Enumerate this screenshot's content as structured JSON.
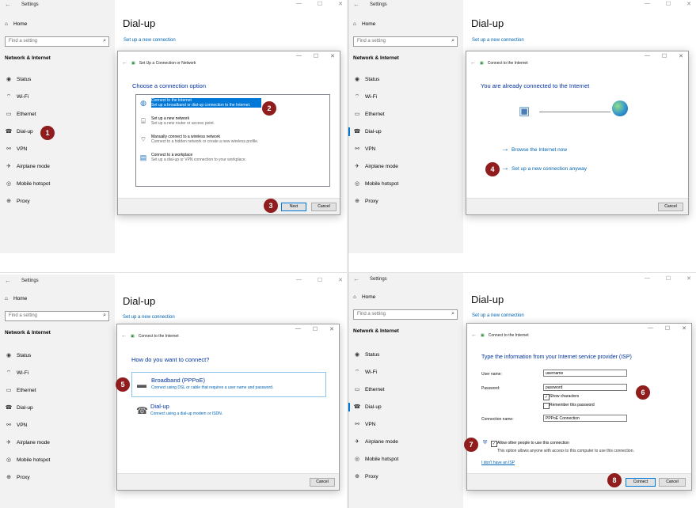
{
  "settings": {
    "app_title": "Settings",
    "home": "Home",
    "search_placeholder": "Find a setting",
    "section": "Network & Internet",
    "nav": [
      "Status",
      "Wi-Fi",
      "Ethernet",
      "Dial-up",
      "VPN",
      "Airplane mode",
      "Mobile hotspot",
      "Proxy"
    ],
    "page_title": "Dial-up",
    "setup_link": "Set up a new connection"
  },
  "step1": {
    "dialog_title": "Set Up a Connection or Network",
    "heading": "Choose a connection option",
    "options": [
      {
        "title": "Connect to the Internet",
        "desc": "Set up a broadband or dial-up connection to the Internet."
      },
      {
        "title": "Set up a new network",
        "desc": "Set up a new router or access point."
      },
      {
        "title": "Manually connect to a wireless network",
        "desc": "Connect to a hidden network or create a new wireless profile."
      },
      {
        "title": "Connect to a workplace",
        "desc": "Set up a dial-up or VPN connection to your workplace."
      }
    ],
    "next": "Next",
    "cancel": "Cancel"
  },
  "step2": {
    "dialog_title": "Connect to the Internet",
    "heading": "You are already connected to the Internet",
    "browse": "Browse the Internet now",
    "setup_anyway": "Set up a new connection anyway",
    "cancel": "Cancel"
  },
  "step3": {
    "dialog_title": "Connect to the Internet",
    "heading": "How do you want to connect?",
    "broadband_title": "Broadband (PPPoE)",
    "broadband_desc": "Connect using DSL or cable that requires a user name and password.",
    "dialup_title": "Dial-up",
    "dialup_desc": "Connect using a dial-up modem or ISDN.",
    "cancel": "Cancel"
  },
  "step4": {
    "dialog_title": "Connect to the Internet",
    "heading": "Type the information from your Internet service provider (ISP)",
    "user_label": "User name:",
    "user_value": "username",
    "password_label": "Password:",
    "password_value": "password",
    "show_chars": "Show characters",
    "remember": "Remember this password",
    "conn_label": "Connection name:",
    "conn_value": "PPPoE Connection",
    "allow": "Allow other people to use this connection",
    "allow_desc": "This option allows anyone with access to this computer to use this connection.",
    "no_isp": "I don't have an ISP",
    "connect": "Connect",
    "cancel": "Cancel"
  },
  "badges": [
    "1",
    "2",
    "3",
    "4",
    "5",
    "6",
    "7",
    "8"
  ],
  "colors": {
    "badge": "#8f1d1d",
    "accent": "#0078d7",
    "link": "#0063b1",
    "heading": "#0033a0"
  }
}
